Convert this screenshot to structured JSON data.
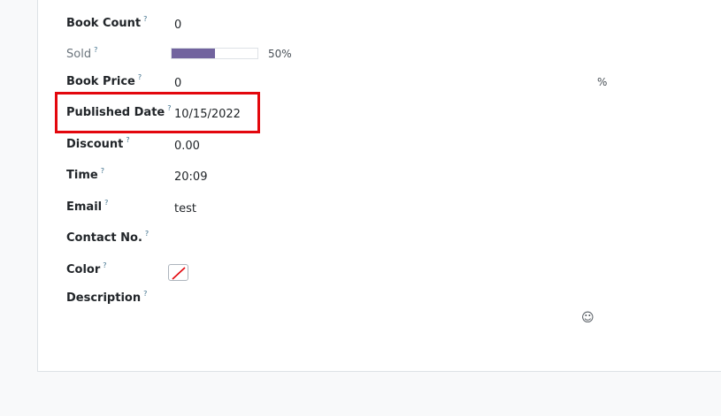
{
  "help_mark": "?",
  "fields": {
    "book_count": {
      "label": "Book Count",
      "value": "0"
    },
    "sold": {
      "label": "Sold",
      "progress_fraction": 0.5,
      "progress_text": "50%"
    },
    "book_price": {
      "label": "Book Price",
      "value": "0",
      "suffix": "%"
    },
    "published_date": {
      "label": "Published Date",
      "value": "10/15/2022"
    },
    "discount": {
      "label": "Discount",
      "value": "0.00"
    },
    "time": {
      "label": "Time",
      "value": "20:09"
    },
    "email": {
      "label": "Email",
      "value": "test"
    },
    "contact_no": {
      "label": "Contact No.",
      "value": ""
    },
    "color": {
      "label": "Color",
      "value": "",
      "swatch": "no-color-icon"
    },
    "description": {
      "label": "Description",
      "value": "",
      "emoji_icon": "emoji-picker-icon"
    }
  },
  "colors": {
    "progress_fill": "#71639e",
    "highlight_border": "#e3070d",
    "help_mark": "#3c6e8a"
  }
}
